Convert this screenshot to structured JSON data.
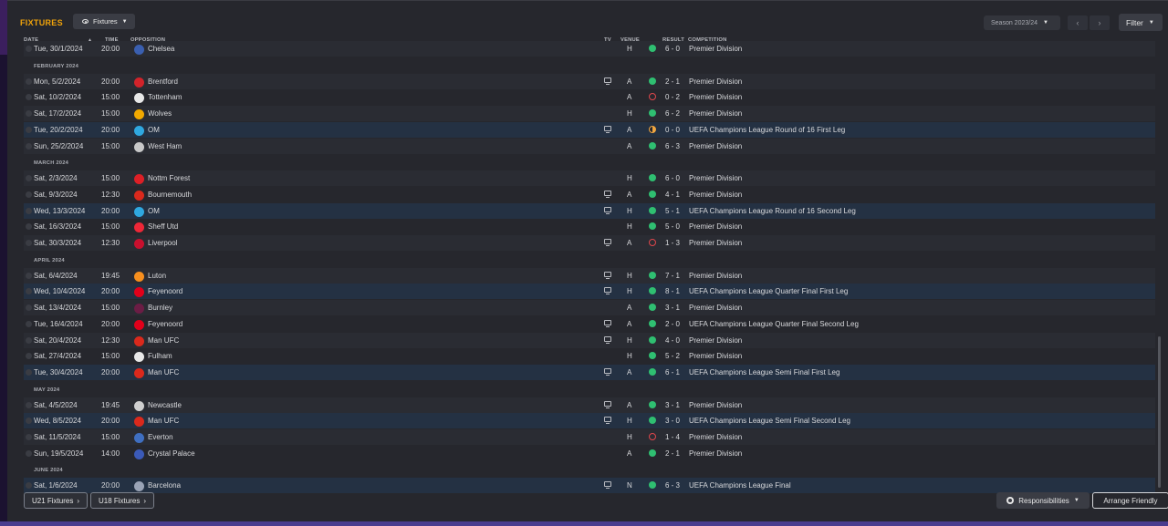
{
  "header": {
    "title": "FIXTURES",
    "view_label": "Fixtures",
    "season_label": "Season 2023/24",
    "filter_label": "Filter"
  },
  "columns": {
    "date": "DATE",
    "time": "TIME",
    "opposition": "OPPOSITION",
    "tv": "TV",
    "venue": "VENUE",
    "result": "RESULT",
    "competition": "COMPETITION"
  },
  "items": [
    {
      "kind": "row",
      "date": "Tue, 30/1/2024",
      "time": "20:00",
      "opp": "Chelsea",
      "tv": false,
      "venue": "H",
      "res": "W",
      "score": "6 - 0",
      "comp": "Premier Division",
      "crest": "#3a5fb0",
      "style": "alt"
    },
    {
      "kind": "month",
      "label": "FEBRUARY 2024"
    },
    {
      "kind": "row",
      "date": "Mon, 5/2/2024",
      "time": "20:00",
      "opp": "Brentford",
      "tv": true,
      "venue": "A",
      "res": "W",
      "score": "2 - 1",
      "comp": "Premier Division",
      "crest": "#d2232a",
      "style": "alt"
    },
    {
      "kind": "row",
      "date": "Sat, 10/2/2024",
      "time": "15:00",
      "opp": "Tottenham",
      "tv": false,
      "venue": "A",
      "res": "L",
      "score": "0 - 2",
      "comp": "Premier Division",
      "crest": "#e8e8e8",
      "style": "plain"
    },
    {
      "kind": "row",
      "date": "Sat, 17/2/2024",
      "time": "15:00",
      "opp": "Wolves",
      "tv": false,
      "venue": "H",
      "res": "W",
      "score": "6 - 2",
      "comp": "Premier Division",
      "crest": "#f2a900",
      "style": "alt"
    },
    {
      "kind": "row",
      "date": "Tue, 20/2/2024",
      "time": "20:00",
      "opp": "OM",
      "tv": true,
      "venue": "A",
      "res": "D",
      "score": "0 - 0",
      "comp": "UEFA Champions League Round of 16 First Leg",
      "crest": "#2fa8e0",
      "style": "cl"
    },
    {
      "kind": "row",
      "date": "Sun, 25/2/2024",
      "time": "15:00",
      "opp": "West Ham",
      "tv": false,
      "venue": "A",
      "res": "W",
      "score": "6 - 3",
      "comp": "Premier Division",
      "crest": "#c8c8c8",
      "style": "alt"
    },
    {
      "kind": "month",
      "label": "MARCH 2024"
    },
    {
      "kind": "row",
      "date": "Sat, 2/3/2024",
      "time": "15:00",
      "opp": "Nottm Forest",
      "tv": false,
      "venue": "H",
      "res": "W",
      "score": "6 - 0",
      "comp": "Premier Division",
      "crest": "#dd1f26",
      "style": "alt"
    },
    {
      "kind": "row",
      "date": "Sat, 9/3/2024",
      "time": "12:30",
      "opp": "Bournemouth",
      "tv": true,
      "venue": "A",
      "res": "W",
      "score": "4 - 1",
      "comp": "Premier Division",
      "crest": "#da291c",
      "style": "plain"
    },
    {
      "kind": "row",
      "date": "Wed, 13/3/2024",
      "time": "20:00",
      "opp": "OM",
      "tv": true,
      "venue": "H",
      "res": "W",
      "score": "5 - 1",
      "comp": "UEFA Champions League Round of 16 Second Leg",
      "crest": "#2fa8e0",
      "style": "cl"
    },
    {
      "kind": "row",
      "date": "Sat, 16/3/2024",
      "time": "15:00",
      "opp": "Sheff Utd",
      "tv": false,
      "venue": "H",
      "res": "W",
      "score": "5 - 0",
      "comp": "Premier Division",
      "crest": "#ee2737",
      "style": "plain"
    },
    {
      "kind": "row",
      "date": "Sat, 30/3/2024",
      "time": "12:30",
      "opp": "Liverpool",
      "tv": true,
      "venue": "A",
      "res": "L",
      "score": "1 - 3",
      "comp": "Premier Division",
      "crest": "#c8102e",
      "style": "alt"
    },
    {
      "kind": "month",
      "label": "APRIL 2024"
    },
    {
      "kind": "row",
      "date": "Sat, 6/4/2024",
      "time": "19:45",
      "opp": "Luton",
      "tv": true,
      "venue": "H",
      "res": "W",
      "score": "7 - 1",
      "comp": "Premier Division",
      "crest": "#f78f1e",
      "style": "alt"
    },
    {
      "kind": "row",
      "date": "Wed, 10/4/2024",
      "time": "20:00",
      "opp": "Feyenoord",
      "tv": true,
      "venue": "H",
      "res": "W",
      "score": "8 - 1",
      "comp": "UEFA Champions League Quarter Final First Leg",
      "crest": "#e1001a",
      "style": "cl"
    },
    {
      "kind": "row",
      "date": "Sat, 13/4/2024",
      "time": "15:00",
      "opp": "Burnley",
      "tv": false,
      "venue": "A",
      "res": "W",
      "score": "3 - 1",
      "comp": "Premier Division",
      "crest": "#6c1d45",
      "style": "alt"
    },
    {
      "kind": "row",
      "date": "Tue, 16/4/2024",
      "time": "20:00",
      "opp": "Feyenoord",
      "tv": true,
      "venue": "A",
      "res": "W",
      "score": "2 - 0",
      "comp": "UEFA Champions League Quarter Final Second Leg",
      "crest": "#e1001a",
      "style": "plain"
    },
    {
      "kind": "row",
      "date": "Sat, 20/4/2024",
      "time": "12:30",
      "opp": "Man UFC",
      "tv": true,
      "venue": "H",
      "res": "W",
      "score": "4 - 0",
      "comp": "Premier Division",
      "crest": "#da291c",
      "style": "alt"
    },
    {
      "kind": "row",
      "date": "Sat, 27/4/2024",
      "time": "15:00",
      "opp": "Fulham",
      "tv": false,
      "venue": "H",
      "res": "W",
      "score": "5 - 2",
      "comp": "Premier Division",
      "crest": "#e8e8e8",
      "style": "plain"
    },
    {
      "kind": "row",
      "date": "Tue, 30/4/2024",
      "time": "20:00",
      "opp": "Man UFC",
      "tv": true,
      "venue": "A",
      "res": "W",
      "score": "6 - 1",
      "comp": "UEFA Champions League Semi Final First Leg",
      "crest": "#da291c",
      "style": "cl"
    },
    {
      "kind": "month",
      "label": "MAY 2024"
    },
    {
      "kind": "row",
      "date": "Sat, 4/5/2024",
      "time": "19:45",
      "opp": "Newcastle",
      "tv": true,
      "venue": "A",
      "res": "W",
      "score": "3 - 1",
      "comp": "Premier Division",
      "crest": "#cfcfcf",
      "style": "alt"
    },
    {
      "kind": "row",
      "date": "Wed, 8/5/2024",
      "time": "20:00",
      "opp": "Man UFC",
      "tv": true,
      "venue": "H",
      "res": "W",
      "score": "3 - 0",
      "comp": "UEFA Champions League Semi Final Second Leg",
      "crest": "#da291c",
      "style": "cl"
    },
    {
      "kind": "row",
      "date": "Sat, 11/5/2024",
      "time": "15:00",
      "opp": "Everton",
      "tv": false,
      "venue": "H",
      "res": "L",
      "score": "1 - 4",
      "comp": "Premier Division",
      "crest": "#3f6fc1",
      "style": "alt"
    },
    {
      "kind": "row",
      "date": "Sun, 19/5/2024",
      "time": "14:00",
      "opp": "Crystal Palace",
      "tv": false,
      "venue": "A",
      "res": "W",
      "score": "2 - 1",
      "comp": "Premier Division",
      "crest": "#3b5ab8",
      "style": "plain"
    },
    {
      "kind": "month",
      "label": "JUNE 2024"
    },
    {
      "kind": "row",
      "date": "Sat, 1/6/2024",
      "time": "20:00",
      "opp": "Barcelona",
      "tv": true,
      "venue": "N",
      "res": "W",
      "score": "6 - 3",
      "comp": "UEFA Champions League Final",
      "crest": "#9aa3b5",
      "style": "cl"
    }
  ],
  "footer": {
    "u21_label": "U21 Fixtures",
    "u18_label": "U18 Fixtures",
    "responsibilities_label": "Responsibilities",
    "arrange_label": "Arrange Friendly"
  }
}
